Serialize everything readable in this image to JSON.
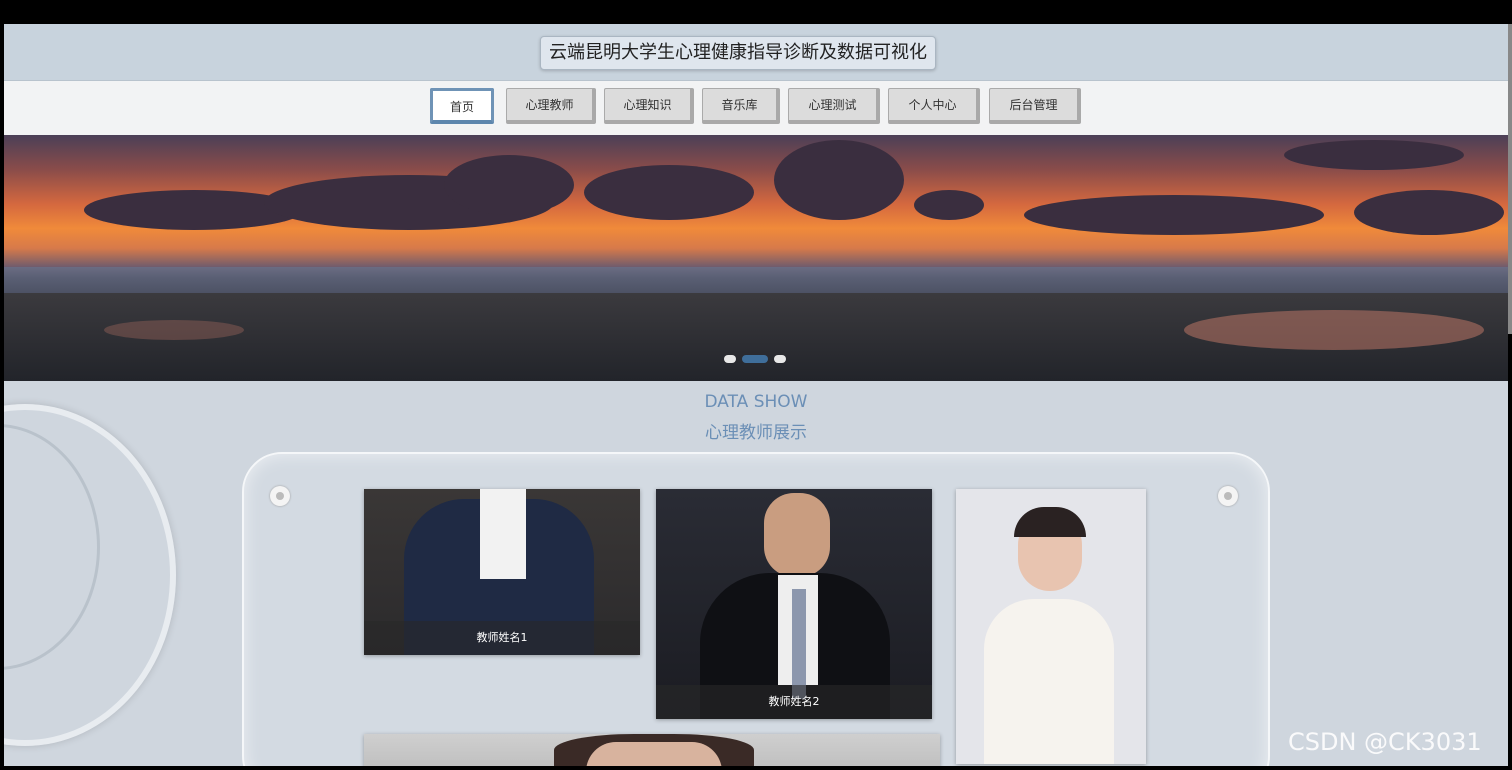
{
  "header": {
    "title": "云端昆明大学生心理健康指导诊断及数据可视化"
  },
  "nav": {
    "items": [
      {
        "label": "首页",
        "active": true
      },
      {
        "label": "心理教师",
        "active": false
      },
      {
        "label": "心理知识",
        "active": false
      },
      {
        "label": "音乐库",
        "active": false
      },
      {
        "label": "心理测试",
        "active": false
      },
      {
        "label": "个人中心",
        "active": false
      },
      {
        "label": "后台管理",
        "active": false
      }
    ]
  },
  "banner": {
    "slides": 3,
    "active_slide": 2
  },
  "section": {
    "subtitle_en": "DATA SHOW",
    "title": "心理教师展示"
  },
  "teachers": [
    {
      "name": "教师姓名1"
    },
    {
      "name": "教师姓名2"
    },
    {
      "name": ""
    }
  ],
  "watermark": "CSDN @CK3031",
  "colors": {
    "accent": "#6b8fb6",
    "nav_active_border": "#6f93b6",
    "header_bg": "#c8d3dd"
  }
}
